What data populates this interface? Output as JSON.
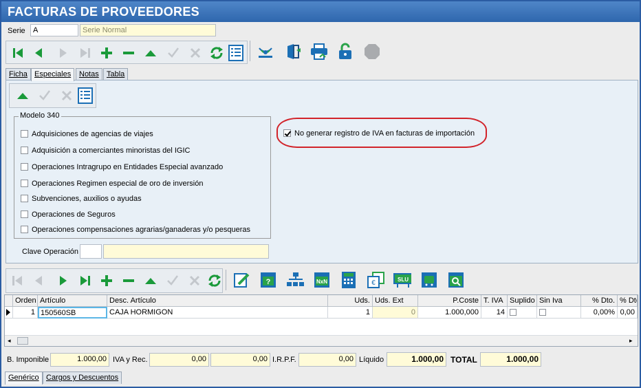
{
  "window": {
    "title": "FACTURAS DE PROVEEDORES"
  },
  "header": {
    "serie_label": "Serie",
    "serie_value": "A",
    "serie_desc": "Serie Normal"
  },
  "tabs": [
    {
      "label": "Ficha"
    },
    {
      "label": "Especiales"
    },
    {
      "label": "Notas"
    },
    {
      "label": "Tabla"
    }
  ],
  "modelo340": {
    "title": "Modelo 340",
    "options": [
      {
        "label": "Adquisiciones de agencias de viajes",
        "checked": false
      },
      {
        "label": "Adquisición a comerciantes minoristas del IGIC",
        "checked": false
      },
      {
        "label": "Operaciones Intragrupo en Entidades Especial avanzado",
        "checked": false
      },
      {
        "label": "Operaciones Regimen especial de oro de inversión",
        "checked": false
      },
      {
        "label": "Subvenciones, auxilios o ayudas",
        "checked": false
      },
      {
        "label": "Operaciones de Seguros",
        "checked": false
      },
      {
        "label": "Operaciones compensaciones agrarias/ganaderas y/o pesqueras",
        "checked": false
      }
    ]
  },
  "iva_option": {
    "label": "No generar registro de IVA en facturas de importación",
    "checked": true
  },
  "clave_operacion": {
    "label": "Clave Operación",
    "code": "",
    "desc": ""
  },
  "grid": {
    "columns": [
      "Orden",
      "Artículo",
      "Desc. Artículo",
      "Uds.",
      "Uds. Ext",
      "P.Coste",
      "T. IVA",
      "Suplido",
      "Sin Iva",
      "% Dto.",
      "% Dto"
    ],
    "rows": [
      {
        "orden": "1",
        "articulo": "150560SB",
        "desc": "CAJA HORMIGON",
        "uds": "1",
        "uds_ext": "0",
        "pcoste": "1.000,000",
        "tiva": "14",
        "suplido": false,
        "siniva": false,
        "dto1": "0,00%",
        "dto2": "0,00"
      }
    ]
  },
  "totals": {
    "b_imponible_label": "B. Imponible",
    "b_imponible": "1.000,00",
    "iva_rec_label": "IVA y Rec.",
    "iva": "0,00",
    "rec": "0,00",
    "irpf_label": "I.R.P.F.",
    "irpf": "0,00",
    "liquido_label": "Líquido",
    "liquido": "1.000,00",
    "total_label": "TOTAL",
    "total": "1.000,00"
  },
  "bottom_tabs": [
    {
      "label": "Genérico"
    },
    {
      "label": "Cargos y Descuentos"
    }
  ],
  "colors": {
    "title_bar": "#2e66ad",
    "nav_green": "#1a9a3a",
    "icon_blue": "#1b6fb5",
    "accent_red": "#d2232a"
  },
  "icons": {
    "main_toolbar": [
      "first-record-icon",
      "previous-record-icon",
      "next-record-icon",
      "last-record-icon",
      "add-icon",
      "delete-icon",
      "up-icon",
      "confirm-icon",
      "cancel-icon",
      "refresh-icon",
      "list-icon",
      "wireless-icon",
      "exit-door-icon",
      "print-icon",
      "unlock-icon",
      "stop-icon"
    ],
    "inner_toolbar": [
      "up-icon",
      "confirm-icon",
      "cancel-icon",
      "list-icon"
    ],
    "lines_toolbar": [
      "first-record-icon",
      "previous-record-icon",
      "next-record-icon",
      "last-record-icon",
      "add-icon",
      "delete-icon",
      "up-icon",
      "confirm-icon",
      "cancel-icon",
      "refresh-icon",
      "edit-icon",
      "help-icon",
      "tree-icon",
      "nxn-icon",
      "calculator-icon",
      "currency-icon",
      "slu-icon",
      "transport-icon",
      "search-icon"
    ]
  }
}
